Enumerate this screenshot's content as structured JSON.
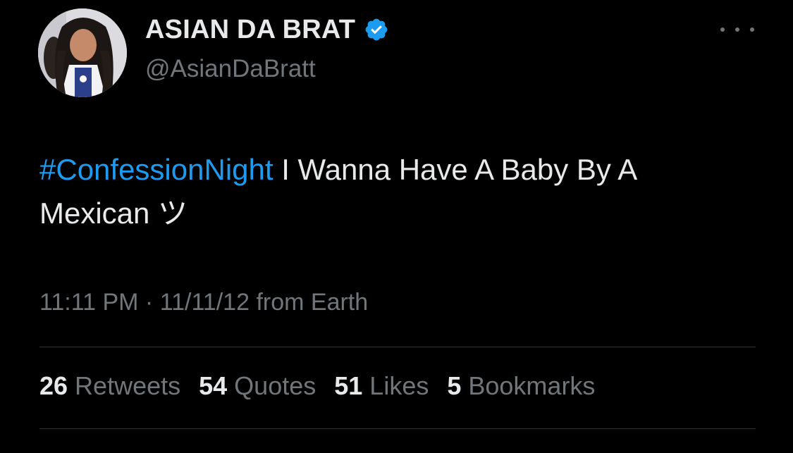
{
  "tweet": {
    "display_name": "ASIAN DA BRAT",
    "handle": "@AsianDaBratt",
    "verified_icon": "verified-badge-icon",
    "more_icon": "more-dots-icon",
    "text_hashtag": "#ConfessionNight",
    "text_body": " I Wanna Have A Baby By A Mexican ツ",
    "meta": "11:11 PM · 11/11/12 from Earth",
    "stats": [
      {
        "count": "26",
        "label": "Retweets"
      },
      {
        "count": "54",
        "label": "Quotes"
      },
      {
        "count": "51",
        "label": "Likes"
      },
      {
        "count": "5",
        "label": "Bookmarks"
      }
    ]
  },
  "colors": {
    "background": "#000000",
    "text": "#e7e9ea",
    "secondary": "#71767b",
    "accent": "#1d9bf0",
    "divider": "#2f3336"
  }
}
